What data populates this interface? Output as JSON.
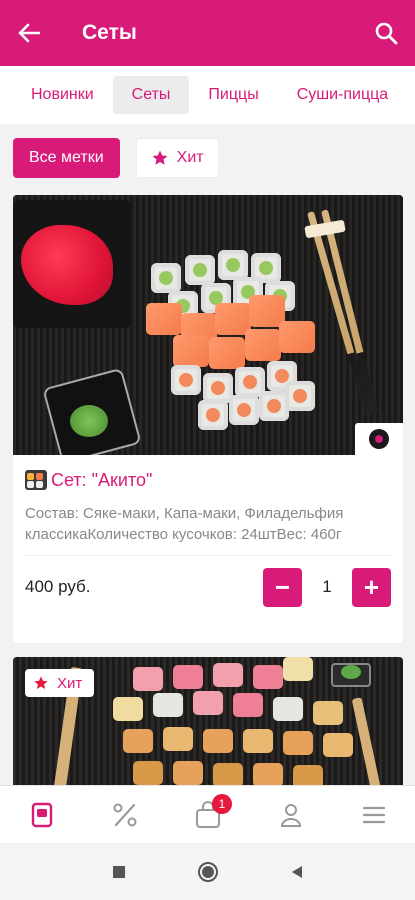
{
  "header": {
    "title": "Сеты",
    "back_icon": "arrow-left-icon",
    "search_icon": "search-icon",
    "accent": "#d81b79"
  },
  "tabs": [
    {
      "label": "Новинки"
    },
    {
      "label": "Сеты",
      "active": true
    },
    {
      "label": "Пиццы"
    },
    {
      "label": "Суши-пицца"
    }
  ],
  "filters": {
    "all_label": "Все метки",
    "hit_label": "Хит"
  },
  "products": [
    {
      "title": "Сет: \"Акито\"",
      "description": "Состав: Сяке-маки, Капа-маки, Филадельфия классикаКоличество кусочков: 24штВес: 460г",
      "price": "400 руб.",
      "quantity": "1",
      "minus": "−",
      "plus": "+"
    },
    {
      "badge": "Хит"
    }
  ],
  "bottom_nav": {
    "items": [
      "menu-icon",
      "discount-icon",
      "cart-icon",
      "profile-icon",
      "more-icon"
    ],
    "cart_count": "1"
  }
}
